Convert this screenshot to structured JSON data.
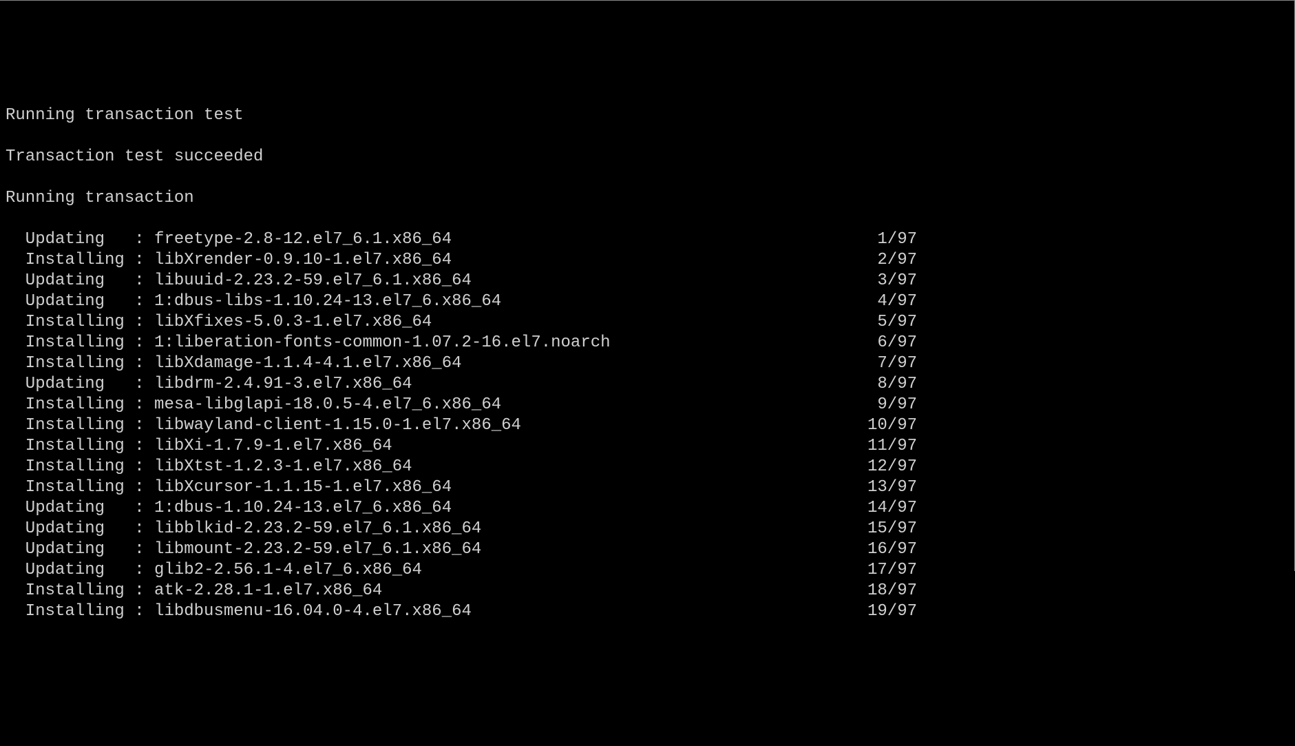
{
  "header": {
    "line1": "Running transaction test",
    "line2": "Transaction test succeeded",
    "line3": "Running transaction"
  },
  "total": 97,
  "packages": [
    {
      "action": "Updating",
      "name": "freetype-2.8-12.el7_6.1.x86_64",
      "idx": 1
    },
    {
      "action": "Installing",
      "name": "libXrender-0.9.10-1.el7.x86_64",
      "idx": 2
    },
    {
      "action": "Updating",
      "name": "libuuid-2.23.2-59.el7_6.1.x86_64",
      "idx": 3
    },
    {
      "action": "Updating",
      "name": "1:dbus-libs-1.10.24-13.el7_6.x86_64",
      "idx": 4
    },
    {
      "action": "Installing",
      "name": "libXfixes-5.0.3-1.el7.x86_64",
      "idx": 5
    },
    {
      "action": "Installing",
      "name": "1:liberation-fonts-common-1.07.2-16.el7.noarch",
      "idx": 6
    },
    {
      "action": "Installing",
      "name": "libXdamage-1.1.4-4.1.el7.x86_64",
      "idx": 7
    },
    {
      "action": "Updating",
      "name": "libdrm-2.4.91-3.el7.x86_64",
      "idx": 8
    },
    {
      "action": "Installing",
      "name": "mesa-libglapi-18.0.5-4.el7_6.x86_64",
      "idx": 9
    },
    {
      "action": "Installing",
      "name": "libwayland-client-1.15.0-1.el7.x86_64",
      "idx": 10
    },
    {
      "action": "Installing",
      "name": "libXi-1.7.9-1.el7.x86_64",
      "idx": 11
    },
    {
      "action": "Installing",
      "name": "libXtst-1.2.3-1.el7.x86_64",
      "idx": 12
    },
    {
      "action": "Installing",
      "name": "libXcursor-1.1.15-1.el7.x86_64",
      "idx": 13
    },
    {
      "action": "Updating",
      "name": "1:dbus-1.10.24-13.el7_6.x86_64",
      "idx": 14
    },
    {
      "action": "Updating",
      "name": "libblkid-2.23.2-59.el7_6.1.x86_64",
      "idx": 15
    },
    {
      "action": "Updating",
      "name": "libmount-2.23.2-59.el7_6.1.x86_64",
      "idx": 16
    },
    {
      "action": "Updating",
      "name": "glib2-2.56.1-4.el7_6.x86_64",
      "idx": 17
    },
    {
      "action": "Installing",
      "name": "atk-2.28.1-1.el7.x86_64",
      "idx": 18
    },
    {
      "action": "Installing",
      "name": "libdbusmenu-16.04.0-4.el7.x86_64",
      "idx": 19
    }
  ]
}
